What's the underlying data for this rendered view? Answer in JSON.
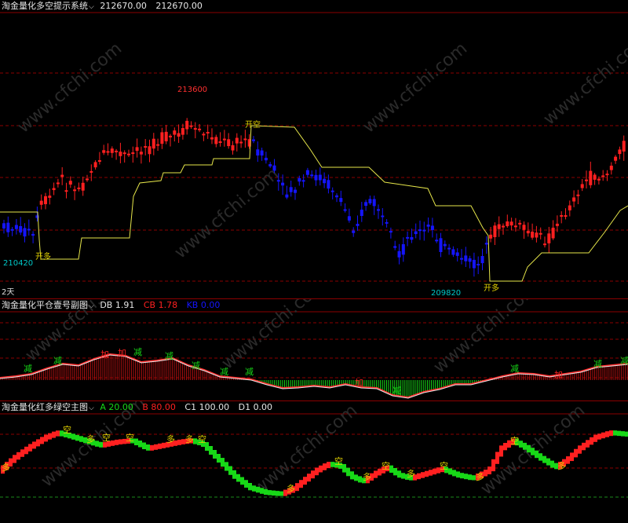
{
  "colors": {
    "up": "#ff2020",
    "down": "#1515ff",
    "line": "#e6e64a",
    "grid": "#8b0000",
    "green": "#17d817",
    "cyan": "#00c8c8",
    "yellow": "#e0d000"
  },
  "pane1": {
    "title": "淘金量化多空提示系统",
    "chevron": "chevron-down-icon",
    "values": [
      "212670.00",
      "212670.00"
    ],
    "high_label": "213600",
    "low_label_left": "210420",
    "low_label_right": "209820",
    "signal_kaikong": "开空",
    "signal_kaiduo_1": "开多",
    "signal_kaiduo_2": "开多",
    "period": "2天"
  },
  "pane2": {
    "title": "淘金量化平仓壹号副图",
    "chevron": "chevron-down-icon",
    "items": [
      {
        "label": "DB",
        "value": "1.91",
        "color": "#e6e6e6"
      },
      {
        "label": "CB",
        "value": "1.78",
        "color": "#ff2020"
      },
      {
        "label": "KB",
        "value": "0.00",
        "color": "#1515ff"
      }
    ],
    "mark_add": "加",
    "mark_reduce": "减"
  },
  "pane3": {
    "title": "淘金量化红多绿空主图",
    "chevron": "chevron-down-icon",
    "items": [
      {
        "label": "A",
        "value": "20.00",
        "color": "#17d817"
      },
      {
        "label": "B",
        "value": "80.00",
        "color": "#ff2020"
      },
      {
        "label": "C1",
        "value": "100.00",
        "color": "#e6e6e6"
      },
      {
        "label": "D1",
        "value": "0.00",
        "color": "#e6e6e6"
      }
    ],
    "mark_kong": "空",
    "mark_duo": "多"
  },
  "watermark": "www.cfchi.com"
}
